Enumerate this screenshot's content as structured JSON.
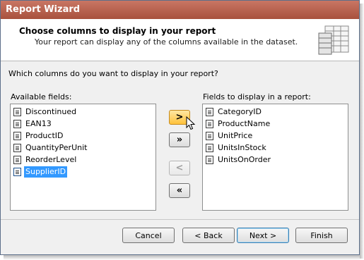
{
  "window": {
    "title": "Report Wizard"
  },
  "header": {
    "title": "Choose columns to display in your report",
    "subtitle": "Your report can display any of the columns available in the dataset.",
    "icon": "table-columns-icon"
  },
  "question": "Which columns do you want to display in your report?",
  "available": {
    "label": "Available fields:",
    "items": [
      {
        "label": "Discontinued"
      },
      {
        "label": "EAN13"
      },
      {
        "label": "ProductID"
      },
      {
        "label": "QuantityPerUnit"
      },
      {
        "label": "ReorderLevel"
      },
      {
        "label": "SupplierID",
        "selected": true
      }
    ]
  },
  "display": {
    "label": "Fields to display in a report:",
    "items": [
      {
        "label": "CategoryID"
      },
      {
        "label": "ProductName"
      },
      {
        "label": "UnitPrice"
      },
      {
        "label": "UnitsInStock"
      },
      {
        "label": "UnitsOnOrder"
      }
    ]
  },
  "move_buttons": {
    "add": ">",
    "add_all": "»",
    "remove": "<",
    "remove_all": "«"
  },
  "buttons": {
    "cancel": "Cancel",
    "back": "< Back",
    "next": "Next >",
    "finish": "Finish"
  },
  "colors": {
    "titlebar": "#b35c48",
    "selection": "#3399ff",
    "hover_button": "#ffc23c"
  }
}
